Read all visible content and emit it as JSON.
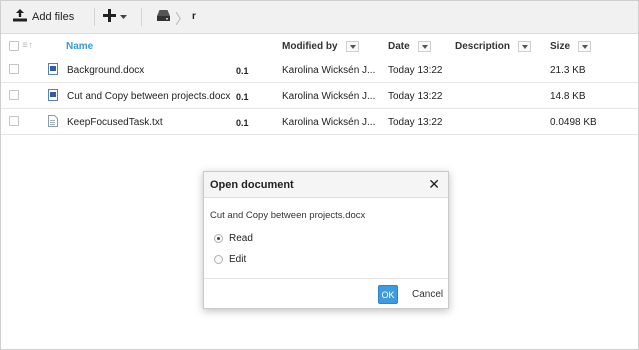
{
  "toolbar": {
    "add_files_label": "Add files",
    "breadcrumb_folder": "r"
  },
  "table": {
    "headers": {
      "name": "Name",
      "modified_by": "Modified by",
      "date": "Date",
      "description": "Description",
      "size": "Size"
    },
    "rows": [
      {
        "name": "Background.docx",
        "version": "0.1",
        "modified_by": "Karolina Wicksén J...",
        "date": "Today 13:22",
        "description": "",
        "size": "21.3 KB",
        "icon": "word-document-icon"
      },
      {
        "name": "Cut and Copy between projects.docx",
        "version": "0.1",
        "modified_by": "Karolina Wicksén J...",
        "date": "Today 13:22",
        "description": "",
        "size": "14.8 KB",
        "icon": "word-document-icon"
      },
      {
        "name": "KeepFocusedTask.txt",
        "version": "0.1",
        "modified_by": "Karolina Wicksén J...",
        "date": "Today 13:22",
        "description": "",
        "size": "0.0498 KB",
        "icon": "text-document-icon"
      }
    ]
  },
  "dialog": {
    "title": "Open document",
    "close_glyph": "✕",
    "file_name": "Cut and Copy between projects.docx",
    "options": [
      {
        "label": "Read",
        "selected": true
      },
      {
        "label": "Edit",
        "selected": false
      }
    ],
    "ok_label": "OK",
    "cancel_label": "Cancel"
  },
  "colors": {
    "accent": "#3d9be0",
    "name_header": "#3a9ad9",
    "toolbar_bg": "#f1f1f1"
  }
}
